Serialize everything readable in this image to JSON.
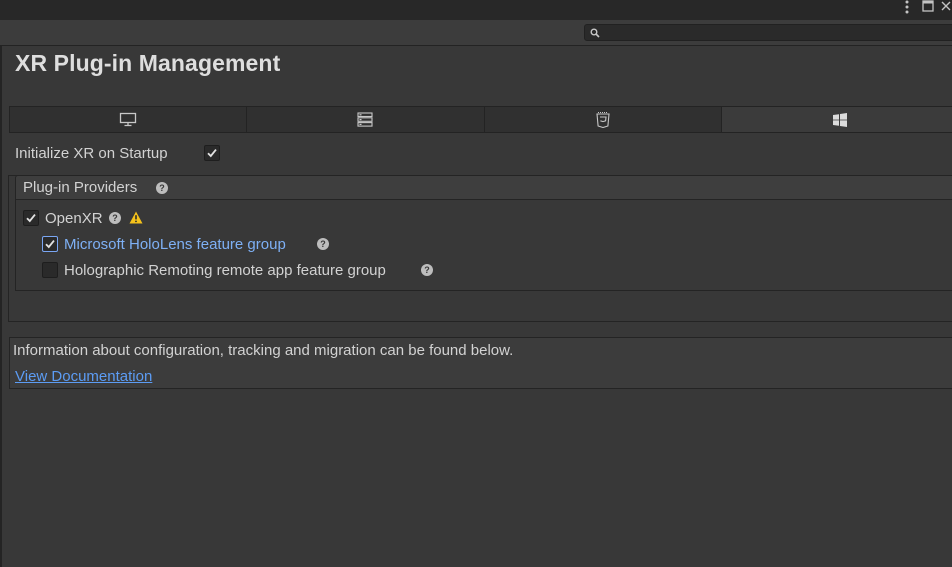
{
  "window": {
    "menu_icon": "kebab-menu-icon",
    "maximize_icon": "maximize-icon",
    "close_icon": "close-icon"
  },
  "search": {
    "placeholder": "",
    "icon": "search-icon"
  },
  "page": {
    "title": "XR Plug-in Management"
  },
  "tabs": [
    {
      "icon": "monitor-icon",
      "platform": "Standalone",
      "active": false
    },
    {
      "icon": "server-icon",
      "platform": "Dedicated Server",
      "active": false
    },
    {
      "icon": "html5-icon",
      "platform": "WebGL",
      "active": false
    },
    {
      "icon": "windows-icon",
      "platform": "Universal Windows Platform",
      "active": true
    }
  ],
  "settings": {
    "initialize_label": "Initialize XR on Startup",
    "initialize_checked": true
  },
  "providers": {
    "header": "Plug-in Providers",
    "items": [
      {
        "label": "OpenXR",
        "checked": true,
        "warning": true
      },
      {
        "label": "Microsoft HoloLens feature group",
        "checked": true
      },
      {
        "label": "Holographic Remoting remote app feature group",
        "checked": false
      }
    ]
  },
  "info": {
    "text": "Information about configuration, tracking and migration can be found below.",
    "link": "View Documentation"
  },
  "colors": {
    "background": "#383838",
    "link": "#5c9cf4",
    "warning": "#f5c21b"
  }
}
